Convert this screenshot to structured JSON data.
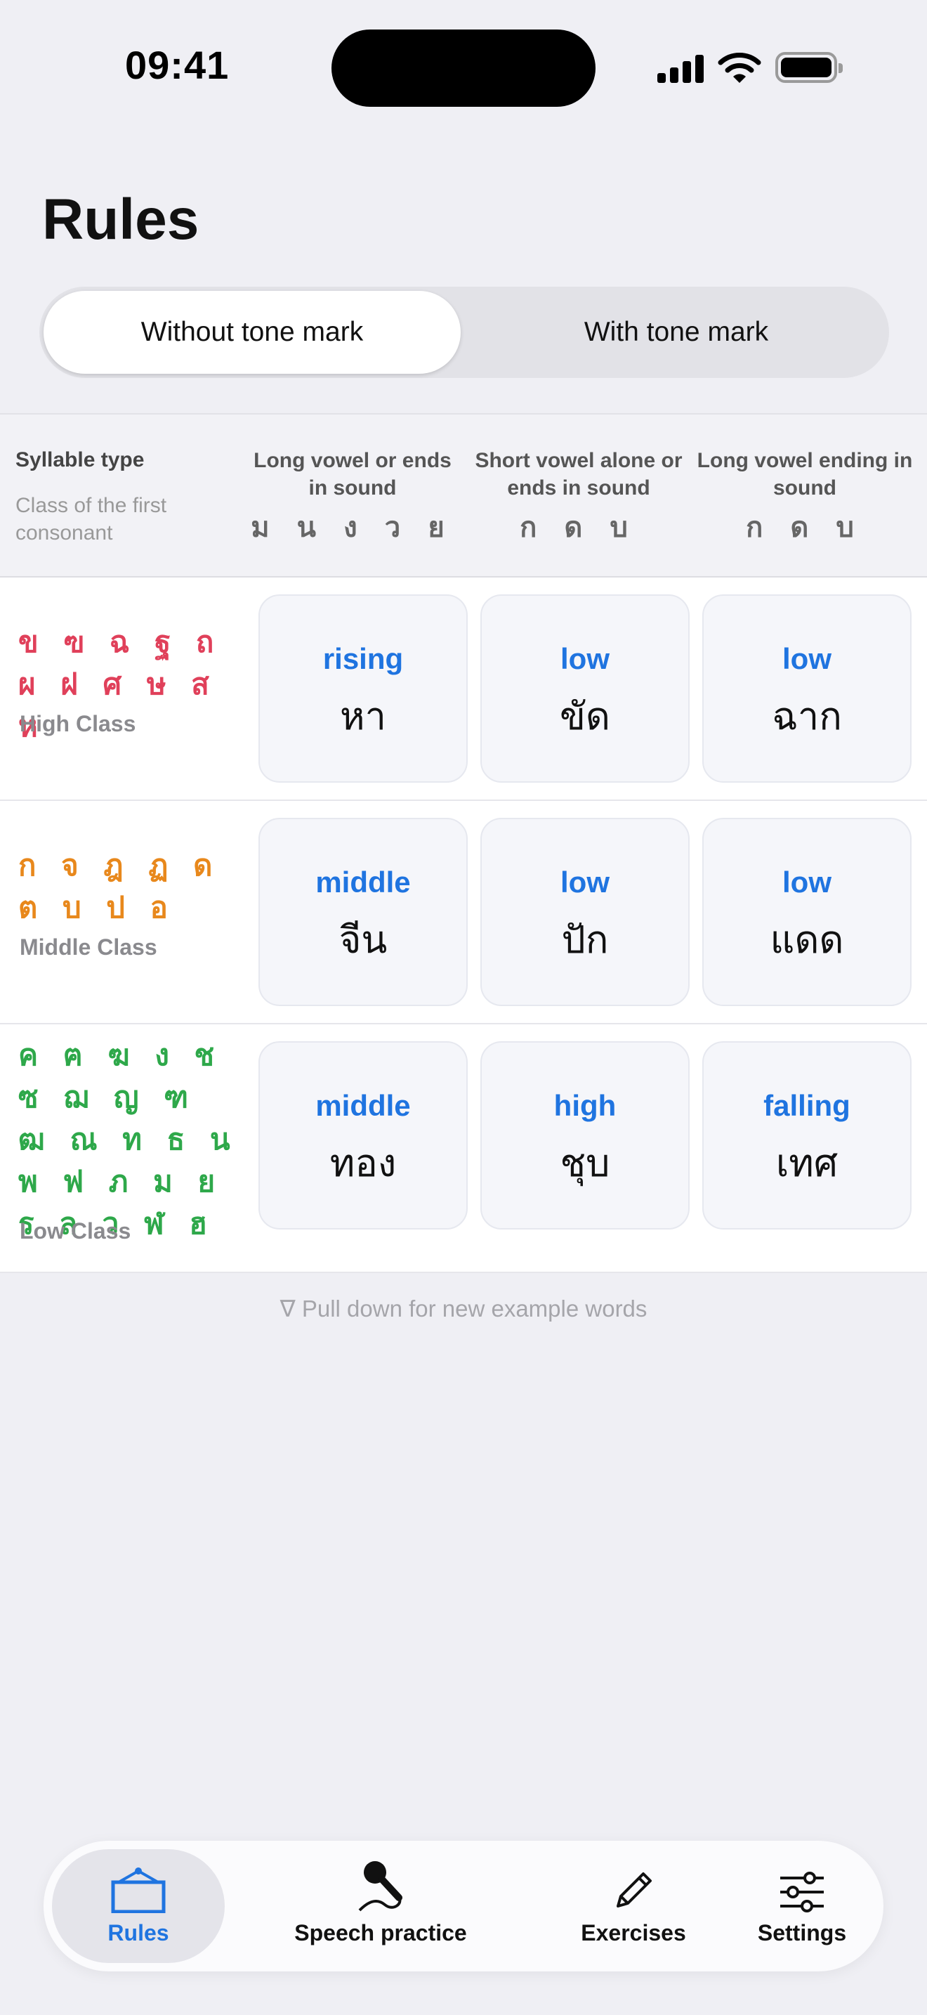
{
  "status_bar": {
    "time": "09:41"
  },
  "page": {
    "title": "Rules"
  },
  "segmented": {
    "options": [
      "Without tone mark",
      "With tone mark"
    ],
    "selected": "Without tone mark"
  },
  "table": {
    "header": {
      "syllable_type": "Syllable type",
      "class_label": "Class of the first consonant",
      "columns": [
        {
          "title": "Long vowel or ends in sound",
          "consonants": "ม น ง ว ย"
        },
        {
          "title": "Short vowel alone or ends in sound",
          "consonants": "ก ด บ"
        },
        {
          "title": "Long vowel ending in sound",
          "consonants": "ก ด บ"
        }
      ]
    },
    "rows": [
      {
        "consonants": "ข ฃ ฉ ฐ ถ ผ ฝ ศ ษ ส ห",
        "class_name": "High Class",
        "color": "#e0405a",
        "cells": [
          {
            "tone": "rising",
            "word": "หา"
          },
          {
            "tone": "low",
            "word": "ขัด"
          },
          {
            "tone": "low",
            "word": "ฉาก"
          }
        ]
      },
      {
        "consonants": "ก จ ฎ ฏ ด ต บ ป อ",
        "class_name": "Middle Class",
        "color": "#e8881c",
        "cells": [
          {
            "tone": "middle",
            "word": "จีน"
          },
          {
            "tone": "low",
            "word": "ปัก"
          },
          {
            "tone": "low",
            "word": "แดด"
          }
        ]
      },
      {
        "consonants": "ค ฅ ฆ ง ช ซ ฌ ญ ฑ ฒ ณ ท ธ น พ ฟ ภ ม ย ร ล ว ฬ ฮ",
        "class_name": "Low Class",
        "color": "#2ea84a",
        "cells": [
          {
            "tone": "middle",
            "word": "ทอง"
          },
          {
            "tone": "high",
            "word": "ชุบ"
          },
          {
            "tone": "falling",
            "word": "เทศ"
          }
        ]
      }
    ]
  },
  "hint": "∇ Pull down for new example words",
  "tabbar": {
    "items": [
      {
        "label": "Rules",
        "icon": "rules-board-icon",
        "active": true
      },
      {
        "label": "Speech practice",
        "icon": "microphone-icon",
        "active": false
      },
      {
        "label": "Exercises",
        "icon": "pencil-icon",
        "active": false
      },
      {
        "label": "Settings",
        "icon": "sliders-icon",
        "active": false
      }
    ]
  },
  "colors": {
    "accent": "#1f74e0",
    "high": "#e0405a",
    "middle": "#e8881c",
    "low": "#2ea84a"
  }
}
